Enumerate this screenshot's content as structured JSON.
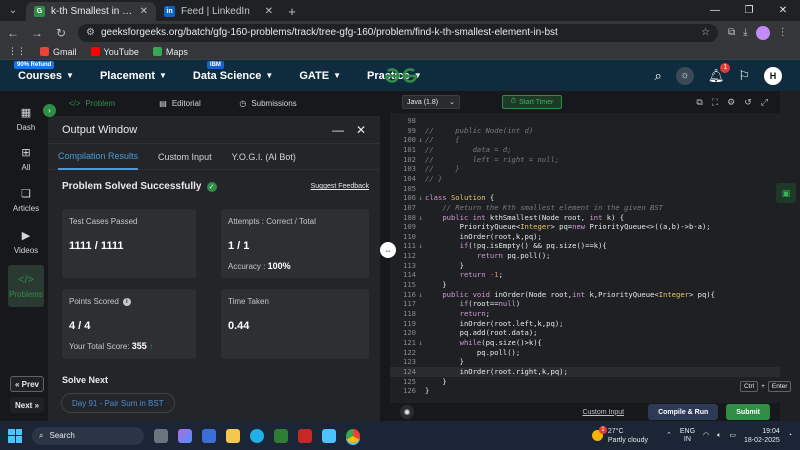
{
  "browser": {
    "tabs": [
      {
        "title": "k-th Smallest in BST | Practice |",
        "favicon": "gfg",
        "active": true
      },
      {
        "title": "Feed | LinkedIn",
        "favicon": "in",
        "active": false
      }
    ],
    "url": "geeksforgeeks.org/batch/gfg-160-problems/track/tree-gfg-160/problem/find-k-th-smallest-element-in-bst",
    "bookmarks": [
      {
        "label": "Gmail",
        "color": "#ea4335"
      },
      {
        "label": "YouTube",
        "color": "#ff0000"
      },
      {
        "label": "Maps",
        "color": "#34a853"
      }
    ]
  },
  "gfg_nav": {
    "items": [
      {
        "label": "Courses",
        "badge": "90% Refund"
      },
      {
        "label": "Placement",
        "badge": ""
      },
      {
        "label": "Data Science",
        "badge": "IBM"
      },
      {
        "label": "GATE",
        "badge": ""
      },
      {
        "label": "Practice",
        "badge": ""
      }
    ],
    "notification_count": "1",
    "avatar_letter": "H",
    "brand_color": "#2f8d46"
  },
  "sidebar": {
    "items": [
      {
        "label": "Dash",
        "icon": "dashboard-icon"
      },
      {
        "label": "All",
        "icon": "grid-icon"
      },
      {
        "label": "Articles",
        "icon": "book-icon"
      },
      {
        "label": "Videos",
        "icon": "video-icon"
      },
      {
        "label": "Problems",
        "icon": "code-icon",
        "active": true
      }
    ],
    "prev_label": "Prev",
    "next_label": "Next"
  },
  "problem_tabs": [
    {
      "label": "Problem",
      "active": true
    },
    {
      "label": "Editorial",
      "active": false
    },
    {
      "label": "Submissions",
      "active": false
    }
  ],
  "output": {
    "title": "Output Window",
    "tabs": [
      {
        "label": "Compilation Results",
        "active": true
      },
      {
        "label": "Custom Input",
        "active": false
      },
      {
        "label": "Y.O.G.I. (AI Bot)",
        "active": false
      }
    ],
    "status": "Problem Solved Successfully",
    "feedback_link": "Suggest Feedback",
    "test_cases_label": "Test Cases Passed",
    "test_cases_value": "1111 / 1111",
    "attempts_label": "Attempts : Correct / Total",
    "attempts_value": "1 / 1",
    "accuracy_label": "Accuracy :",
    "accuracy_value": "100%",
    "points_label": "Points Scored",
    "points_value": "4 / 4",
    "total_score_label": "Your Total Score:",
    "total_score_value": "355",
    "time_label": "Time Taken",
    "time_value": "0.44",
    "solve_next_label": "Solve Next",
    "next_problem": "Day 91 - Pair Sum in BST"
  },
  "editor": {
    "language": "Java (1.8)",
    "timer_label": "Start Timer",
    "lines": [
      {
        "n": "98",
        "fold": "",
        "html": ""
      },
      {
        "n": "99",
        "fold": "",
        "html": "<span class='cm'>//     public Node(int d)</span>"
      },
      {
        "n": "100",
        "fold": "↓",
        "html": "<span class='cm'>//     {</span>"
      },
      {
        "n": "101",
        "fold": "",
        "html": "<span class='cm'>//         data = d;</span>"
      },
      {
        "n": "102",
        "fold": "",
        "html": "<span class='cm'>//         left = right = null;</span>"
      },
      {
        "n": "103",
        "fold": "",
        "html": "<span class='cm'>//     }</span>"
      },
      {
        "n": "104",
        "fold": "",
        "html": "<span class='cm'>// }</span>"
      },
      {
        "n": "105",
        "fold": "",
        "html": ""
      },
      {
        "n": "106",
        "fold": "↓",
        "html": "<span class='kw'>class</span> <span class='ty'>Solution</span> {"
      },
      {
        "n": "107",
        "fold": "",
        "html": "    <span class='cm'>// Return the Kth smallest element in the given BST</span>"
      },
      {
        "n": "108",
        "fold": "↓",
        "html": "    <span class='kw'>public int</span> kthSmallest(Node root, <span class='kw'>int</span> k) {"
      },
      {
        "n": "109",
        "fold": "",
        "html": "        PriorityQueue&lt;<span class='ty'>Integer</span>&gt; pq=<span class='kw'>new</span> PriorityQueue&lt;&gt;((a,b)-&gt;b-a);"
      },
      {
        "n": "110",
        "fold": "",
        "html": "        inOrder(root,k,pq);"
      },
      {
        "n": "111",
        "fold": "↓",
        "html": "        <span class='kw'>if</span>(!pq.isEmpty() &amp;&amp; pq.size()==k){"
      },
      {
        "n": "112",
        "fold": "",
        "html": "            <span class='kw'>return</span> pq.poll();"
      },
      {
        "n": "113",
        "fold": "",
        "html": "        }"
      },
      {
        "n": "114",
        "fold": "",
        "html": "        <span class='kw'>return</span> <span class='nm'>-1</span>;"
      },
      {
        "n": "115",
        "fold": "",
        "html": "    }"
      },
      {
        "n": "116",
        "fold": "↓",
        "html": "    <span class='kw'>public void</span> inOrder(Node root,<span class='kw'>int</span> k,PriorityQueue&lt;<span class='ty'>Integer</span>&gt; pq){"
      },
      {
        "n": "117",
        "fold": "",
        "html": "        <span class='kw'>if</span>(root==<span class='kw'>null</span>)"
      },
      {
        "n": "118",
        "fold": "",
        "html": "        <span class='kw'>return</span>;"
      },
      {
        "n": "119",
        "fold": "",
        "html": "        inOrder(root.left,k,pq);"
      },
      {
        "n": "120",
        "fold": "",
        "html": "        pq.add(root.data);"
      },
      {
        "n": "121",
        "fold": "↓",
        "html": "        <span class='kw'>while</span>(pq.size()&gt;k){"
      },
      {
        "n": "122",
        "fold": "",
        "html": "            pq.poll();"
      },
      {
        "n": "123",
        "fold": "",
        "html": "        }"
      },
      {
        "n": "124",
        "fold": "",
        "html": "        inOrder(root.right,k,pq);",
        "highlight": true
      },
      {
        "n": "125",
        "fold": "",
        "html": "    }"
      },
      {
        "n": "126",
        "fold": "",
        "html": "}"
      }
    ],
    "shortcut_key1": "Ctrl",
    "shortcut_plus": "+",
    "shortcut_key2": "Enter",
    "custom_input_label": "Custom Input",
    "compile_run_label": "Compile & Run",
    "submit_label": "Submit"
  },
  "taskbar": {
    "search_placeholder": "Search",
    "weather_temp": "27°C",
    "weather_desc": "Partly cloudy",
    "weather_badge": "1",
    "lang_top": "ENG",
    "lang_bottom": "IN",
    "time": "19:04",
    "date": "18-02-2025"
  }
}
